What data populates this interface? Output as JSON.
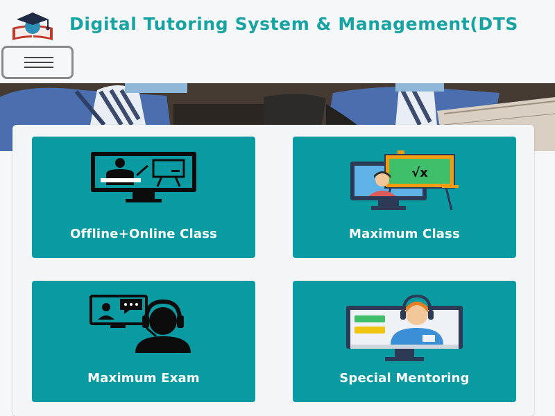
{
  "header": {
    "title": "Digital Tutoring System & Management(DTS",
    "logo": "graduation-cap-book-logo",
    "menu_icon": "hamburger-menu-icon"
  },
  "colors": {
    "title": "#17a3a3",
    "card_bg": "#0a9ba2",
    "page_bg": "#f6f7f9"
  },
  "cards": [
    {
      "label": "Offline+Online Class",
      "icon": "teacher-presentation-icon"
    },
    {
      "label": "Maximum Class",
      "icon": "online-math-class-icon"
    },
    {
      "label": "Maximum Exam",
      "icon": "video-call-headset-icon"
    },
    {
      "label": "Special Mentoring",
      "icon": "mentor-headset-monitor-icon"
    }
  ]
}
